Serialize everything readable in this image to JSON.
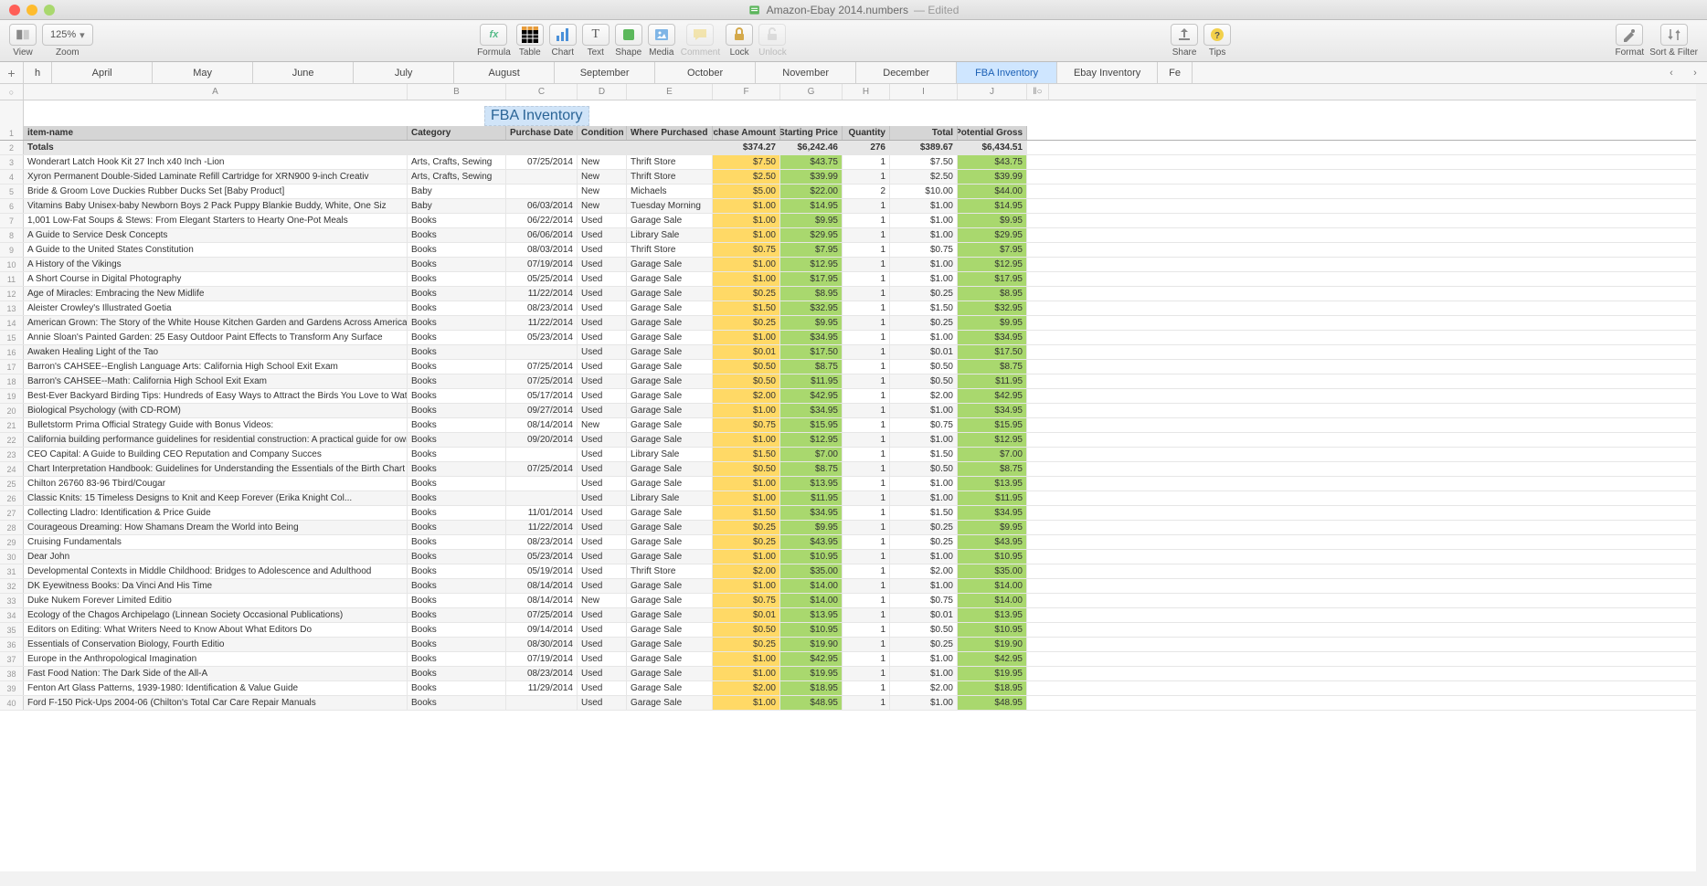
{
  "window": {
    "title": "Amazon-Ebay 2014.numbers",
    "edited": "— Edited"
  },
  "toolbar": {
    "view": "View",
    "zoom": "Zoom",
    "zoom_value": "125%",
    "formula": "Formula",
    "table": "Table",
    "chart": "Chart",
    "text": "Text",
    "shape": "Shape",
    "media": "Media",
    "comment": "Comment",
    "lock": "Lock",
    "unlock": "Unlock",
    "share": "Share",
    "tips": "Tips",
    "format": "Format",
    "sort": "Sort & Filter"
  },
  "tabs": {
    "add": "+",
    "items": [
      "h",
      "April",
      "May",
      "June",
      "July",
      "August",
      "September",
      "October",
      "November",
      "December",
      "FBA Inventory",
      "Ebay Inventory",
      "Fe"
    ],
    "active": "FBA Inventory"
  },
  "cols": {
    "letters": [
      "A",
      "B",
      "C",
      "D",
      "E",
      "F",
      "G",
      "H",
      "I",
      "J"
    ],
    "handles": "○"
  },
  "sheet": {
    "title": "FBA Inventory"
  },
  "headers": [
    "item-name",
    "Category",
    "Purchase Date",
    "Condition",
    "Where Purchased",
    "Purchase Amount",
    "Starting Price",
    "Quantity",
    "Total",
    "Potential Gross"
  ],
  "totals": {
    "label": "Totals",
    "values": [
      "",
      "",
      "",
      "",
      "$374.27",
      "$6,242.46",
      "276",
      "$389.67",
      "$6,434.51"
    ]
  },
  "rows": [
    {
      "n": "Wonderart Latch Hook Kit 27 Inch x40 Inch -Lion",
      "cat": "Arts, Crafts, Sewing",
      "d": "07/25/2014",
      "c": "New",
      "w": "Thrift Store",
      "pa": "$7.50",
      "sp": "$43.75",
      "q": "1",
      "t": "$7.50",
      "pg": "$43.75"
    },
    {
      "n": "Xyron Permanent Double-Sided Laminate Refill Cartridge for XRN900 9-inch Creativ",
      "cat": "Arts, Crafts, Sewing",
      "d": "",
      "c": "New",
      "w": "Thrift Store",
      "pa": "$2.50",
      "sp": "$39.99",
      "q": "1",
      "t": "$2.50",
      "pg": "$39.99"
    },
    {
      "n": "Bride & Groom Love Duckies Rubber Ducks Set [Baby Product]",
      "cat": "Baby",
      "d": "",
      "c": "New",
      "w": "Michaels",
      "pa": "$5.00",
      "sp": "$22.00",
      "q": "2",
      "t": "$10.00",
      "pg": "$44.00"
    },
    {
      "n": "Vitamins Baby Unisex-baby Newborn Boys 2 Pack Puppy Blankie Buddy, White, One Siz",
      "cat": "Baby",
      "d": "06/03/2014",
      "c": "New",
      "w": "Tuesday Morning",
      "pa": "$1.00",
      "sp": "$14.95",
      "q": "1",
      "t": "$1.00",
      "pg": "$14.95"
    },
    {
      "n": "1,001 Low-Fat Soups & Stews: From Elegant Starters to Hearty One-Pot Meals",
      "cat": "Books",
      "d": "06/22/2014",
      "c": "Used",
      "w": "Garage Sale",
      "pa": "$1.00",
      "sp": "$9.95",
      "q": "1",
      "t": "$1.00",
      "pg": "$9.95"
    },
    {
      "n": "A Guide to Service Desk Concepts",
      "cat": "Books",
      "d": "06/06/2014",
      "c": "Used",
      "w": "Library Sale",
      "pa": "$1.00",
      "sp": "$29.95",
      "q": "1",
      "t": "$1.00",
      "pg": "$29.95"
    },
    {
      "n": "A Guide to the United States Constitution",
      "cat": "Books",
      "d": "08/03/2014",
      "c": "Used",
      "w": "Thrift Store",
      "pa": "$0.75",
      "sp": "$7.95",
      "q": "1",
      "t": "$0.75",
      "pg": "$7.95"
    },
    {
      "n": "A History of the Vikings",
      "cat": "Books",
      "d": "07/19/2014",
      "c": "Used",
      "w": "Garage Sale",
      "pa": "$1.00",
      "sp": "$12.95",
      "q": "1",
      "t": "$1.00",
      "pg": "$12.95"
    },
    {
      "n": "A Short Course in Digital Photography",
      "cat": "Books",
      "d": "05/25/2014",
      "c": "Used",
      "w": "Garage Sale",
      "pa": "$1.00",
      "sp": "$17.95",
      "q": "1",
      "t": "$1.00",
      "pg": "$17.95"
    },
    {
      "n": "Age of Miracles: Embracing the New Midlife",
      "cat": "Books",
      "d": "11/22/2014",
      "c": "Used",
      "w": "Garage Sale",
      "pa": "$0.25",
      "sp": "$8.95",
      "q": "1",
      "t": "$0.25",
      "pg": "$8.95"
    },
    {
      "n": "Aleister Crowley's Illustrated Goetia",
      "cat": "Books",
      "d": "08/23/2014",
      "c": "Used",
      "w": "Garage Sale",
      "pa": "$1.50",
      "sp": "$32.95",
      "q": "1",
      "t": "$1.50",
      "pg": "$32.95"
    },
    {
      "n": "American Grown: The Story of the White House Kitchen Garden and Gardens Across America",
      "cat": "Books",
      "d": "11/22/2014",
      "c": "Used",
      "w": "Garage Sale",
      "pa": "$0.25",
      "sp": "$9.95",
      "q": "1",
      "t": "$0.25",
      "pg": "$9.95"
    },
    {
      "n": "Annie Sloan's Painted Garden: 25 Easy Outdoor Paint Effects to Transform Any Surface",
      "cat": "Books",
      "d": "05/23/2014",
      "c": "Used",
      "w": "Garage Sale",
      "pa": "$1.00",
      "sp": "$34.95",
      "q": "1",
      "t": "$1.00",
      "pg": "$34.95"
    },
    {
      "n": "Awaken Healing Light of the Tao",
      "cat": "Books",
      "d": "",
      "c": "Used",
      "w": "Garage Sale",
      "pa": "$0.01",
      "sp": "$17.50",
      "q": "1",
      "t": "$0.01",
      "pg": "$17.50"
    },
    {
      "n": "Barron's CAHSEE--English Language Arts: California High School Exit Exam",
      "cat": "Books",
      "d": "07/25/2014",
      "c": "Used",
      "w": "Garage Sale",
      "pa": "$0.50",
      "sp": "$8.75",
      "q": "1",
      "t": "$0.50",
      "pg": "$8.75"
    },
    {
      "n": "Barron's CAHSEE--Math: California High School Exit Exam",
      "cat": "Books",
      "d": "07/25/2014",
      "c": "Used",
      "w": "Garage Sale",
      "pa": "$0.50",
      "sp": "$11.95",
      "q": "1",
      "t": "$0.50",
      "pg": "$11.95"
    },
    {
      "n": "Best-Ever Backyard Birding Tips: Hundreds of Easy Ways to Attract the Birds You Love to Watch",
      "cat": "Books",
      "d": "05/17/2014",
      "c": "Used",
      "w": "Garage Sale",
      "pa": "$2.00",
      "sp": "$42.95",
      "q": "1",
      "t": "$2.00",
      "pg": "$42.95"
    },
    {
      "n": "Biological Psychology (with CD-ROM)",
      "cat": "Books",
      "d": "09/27/2014",
      "c": "Used",
      "w": "Garage Sale",
      "pa": "$1.00",
      "sp": "$34.95",
      "q": "1",
      "t": "$1.00",
      "pg": "$34.95"
    },
    {
      "n": "Bulletstorm Prima Official Strategy Guide with Bonus Videos:",
      "cat": "Books",
      "d": "08/14/2014",
      "c": "New",
      "w": "Garage Sale",
      "pa": "$0.75",
      "sp": "$15.95",
      "q": "1",
      "t": "$0.75",
      "pg": "$15.95"
    },
    {
      "n": "California building performance guidelines for residential construction: A practical guide for owners of new homes : constr",
      "cat": "Books",
      "d": "09/20/2014",
      "c": "Used",
      "w": "Garage Sale",
      "pa": "$1.00",
      "sp": "$12.95",
      "q": "1",
      "t": "$1.00",
      "pg": "$12.95"
    },
    {
      "n": "CEO Capital: A Guide to Building CEO Reputation and Company Succes",
      "cat": "Books",
      "d": "",
      "c": "Used",
      "w": "Library Sale",
      "pa": "$1.50",
      "sp": "$7.00",
      "q": "1",
      "t": "$1.50",
      "pg": "$7.00"
    },
    {
      "n": "Chart Interpretation Handbook: Guidelines for Understanding the Essentials of the Birth Chart",
      "cat": "Books",
      "d": "07/25/2014",
      "c": "Used",
      "w": "Garage Sale",
      "pa": "$0.50",
      "sp": "$8.75",
      "q": "1",
      "t": "$0.50",
      "pg": "$8.75"
    },
    {
      "n": "Chilton 26760 83-96 Tbird/Cougar",
      "cat": "Books",
      "d": "",
      "c": "Used",
      "w": "Garage Sale",
      "pa": "$1.00",
      "sp": "$13.95",
      "q": "1",
      "t": "$1.00",
      "pg": "$13.95"
    },
    {
      "n": "Classic Knits: 15 Timeless Designs to Knit and Keep Forever (Erika Knight Col...",
      "cat": "Books",
      "d": "",
      "c": "Used",
      "w": "Library Sale",
      "pa": "$1.00",
      "sp": "$11.95",
      "q": "1",
      "t": "$1.00",
      "pg": "$11.95"
    },
    {
      "n": "Collecting Lladro: Identification & Price Guide",
      "cat": "Books",
      "d": "11/01/2014",
      "c": "Used",
      "w": "Garage Sale",
      "pa": "$1.50",
      "sp": "$34.95",
      "q": "1",
      "t": "$1.50",
      "pg": "$34.95"
    },
    {
      "n": "Courageous Dreaming: How Shamans Dream the World into Being",
      "cat": "Books",
      "d": "11/22/2014",
      "c": "Used",
      "w": "Garage Sale",
      "pa": "$0.25",
      "sp": "$9.95",
      "q": "1",
      "t": "$0.25",
      "pg": "$9.95"
    },
    {
      "n": "Cruising Fundamentals",
      "cat": "Books",
      "d": "08/23/2014",
      "c": "Used",
      "w": "Garage Sale",
      "pa": "$0.25",
      "sp": "$43.95",
      "q": "1",
      "t": "$0.25",
      "pg": "$43.95"
    },
    {
      "n": "Dear John",
      "cat": "Books",
      "d": "05/23/2014",
      "c": "Used",
      "w": "Garage Sale",
      "pa": "$1.00",
      "sp": "$10.95",
      "q": "1",
      "t": "$1.00",
      "pg": "$10.95"
    },
    {
      "n": "Developmental Contexts in Middle Childhood: Bridges to Adolescence and Adulthood",
      "cat": "Books",
      "d": "05/19/2014",
      "c": "Used",
      "w": "Thrift Store",
      "pa": "$2.00",
      "sp": "$35.00",
      "q": "1",
      "t": "$2.00",
      "pg": "$35.00"
    },
    {
      "n": "DK Eyewitness Books: Da Vinci And His Time",
      "cat": "Books",
      "d": "08/14/2014",
      "c": "Used",
      "w": "Garage Sale",
      "pa": "$1.00",
      "sp": "$14.00",
      "q": "1",
      "t": "$1.00",
      "pg": "$14.00"
    },
    {
      "n": "Duke Nukem Forever Limited Editio",
      "cat": "Books",
      "d": "08/14/2014",
      "c": "New",
      "w": "Garage Sale",
      "pa": "$0.75",
      "sp": "$14.00",
      "q": "1",
      "t": "$0.75",
      "pg": "$14.00"
    },
    {
      "n": "Ecology of the Chagos Archipelago (Linnean Society Occasional Publications)",
      "cat": "Books",
      "d": "07/25/2014",
      "c": "Used",
      "w": "Garage Sale",
      "pa": "$0.01",
      "sp": "$13.95",
      "q": "1",
      "t": "$0.01",
      "pg": "$13.95"
    },
    {
      "n": "Editors on Editing: What Writers Need to Know About What Editors Do",
      "cat": "Books",
      "d": "09/14/2014",
      "c": "Used",
      "w": "Garage Sale",
      "pa": "$0.50",
      "sp": "$10.95",
      "q": "1",
      "t": "$0.50",
      "pg": "$10.95"
    },
    {
      "n": "Essentials of Conservation Biology, Fourth Editio",
      "cat": "Books",
      "d": "08/30/2014",
      "c": "Used",
      "w": "Garage Sale",
      "pa": "$0.25",
      "sp": "$19.90",
      "q": "1",
      "t": "$0.25",
      "pg": "$19.90"
    },
    {
      "n": "Europe in the Anthropological Imagination",
      "cat": "Books",
      "d": "07/19/2014",
      "c": "Used",
      "w": "Garage Sale",
      "pa": "$1.00",
      "sp": "$42.95",
      "q": "1",
      "t": "$1.00",
      "pg": "$42.95"
    },
    {
      "n": "Fast Food Nation: The Dark Side of the All-A",
      "cat": "Books",
      "d": "08/23/2014",
      "c": "Used",
      "w": "Garage Sale",
      "pa": "$1.00",
      "sp": "$19.95",
      "q": "1",
      "t": "$1.00",
      "pg": "$19.95"
    },
    {
      "n": "Fenton Art Glass Patterns, 1939-1980: Identification & Value Guide",
      "cat": "Books",
      "d": "11/29/2014",
      "c": "Used",
      "w": "Garage Sale",
      "pa": "$2.00",
      "sp": "$18.95",
      "q": "1",
      "t": "$2.00",
      "pg": "$18.95"
    },
    {
      "n": "Ford F-150 Pick-Ups 2004-06 (Chilton's Total Car Care Repair Manuals",
      "cat": "Books",
      "d": "",
      "c": "Used",
      "w": "Garage Sale",
      "pa": "$1.00",
      "sp": "$48.95",
      "q": "1",
      "t": "$1.00",
      "pg": "$48.95"
    }
  ]
}
